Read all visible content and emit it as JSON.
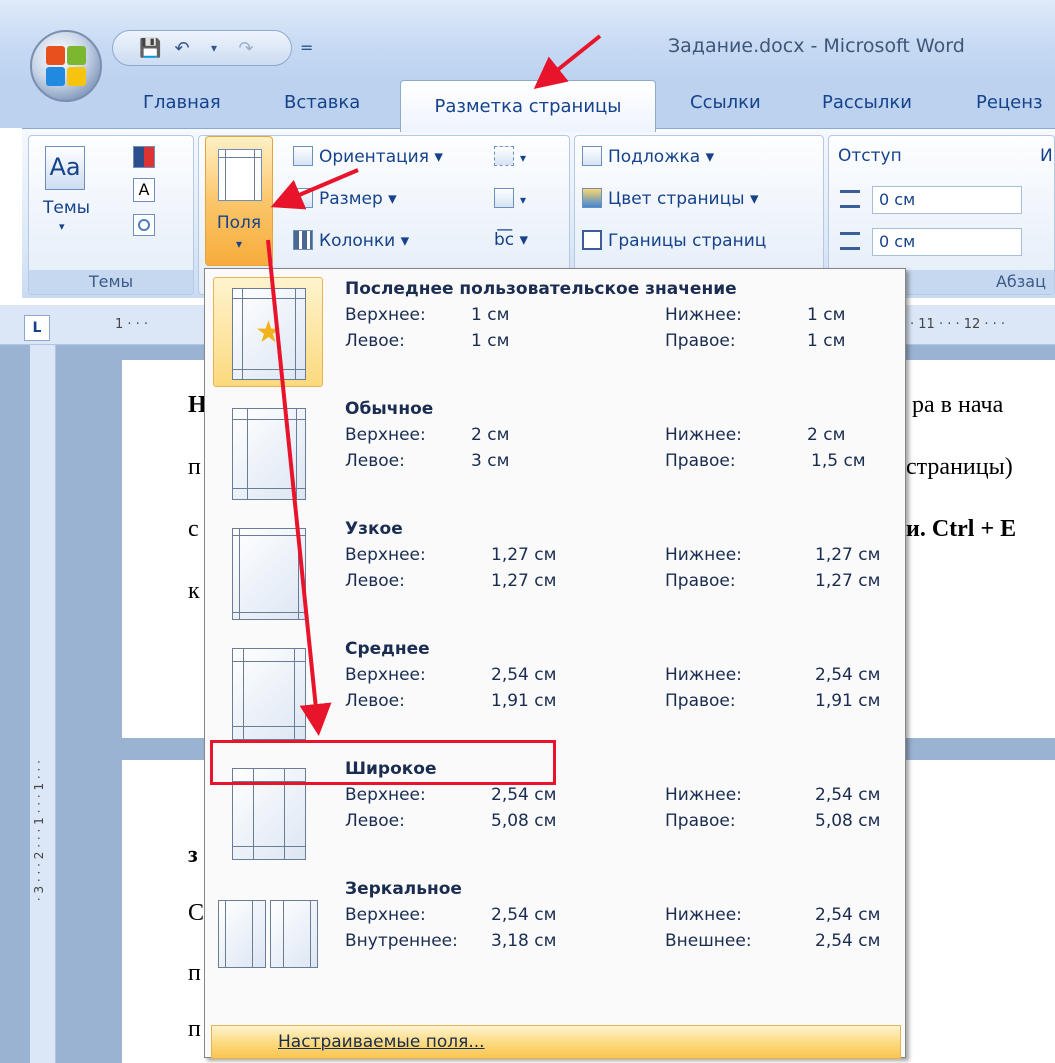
{
  "window": {
    "title": "Задание.docx - Microsoft Word"
  },
  "qat": {
    "save": "💾",
    "undo": "↶",
    "undo_arrow": "▾",
    "redo": "↷",
    "customize": "="
  },
  "tabs": [
    "Главная",
    "Вставка",
    "Разметка страницы",
    "Ссылки",
    "Рассылки",
    "Реценз"
  ],
  "ribbon": {
    "themes": {
      "button": "Темы",
      "arrow": "▾",
      "group": "Темы"
    },
    "page_setup": {
      "margins": "Поля",
      "margins_arrow": "▾",
      "orientation": "Ориентация ▾",
      "size": "Размер ▾",
      "columns": "Колонки ▾",
      "breaks_arrow": "▾",
      "line_numbers_arrow": "▾",
      "hyphenation": "b͞c ▾"
    },
    "page_background": {
      "watermark": "Подложка ▾",
      "page_color": "Цвет страницы ▾",
      "page_borders": "Границы страниц"
    },
    "paragraph": {
      "indent": "Отступ",
      "left_value": "0 см",
      "right_value": "0 см",
      "group": "Абзац",
      "spacing_initial": "И"
    }
  },
  "ruler": {
    "left_marks": "1 · · ·",
    "right_marks": "· 11 · · · 12 · · ·"
  },
  "vruler": {
    "marks": "· 3 · · · 2 · · · 1 · · · 1 · · ·"
  },
  "document": {
    "p1_l1_start": "Н",
    "p1_l1_end": "ра в нача",
    "p1_l2_start": "п",
    "p1_l2_end": "страницы)",
    "p1_l3_start": "с",
    "p1_l3_end": "и. Ctrl + E",
    "p1_l4_start": "к",
    "p2_l1": "з",
    "p2_l2": "С",
    "p2_l3": "п",
    "p2_l4": "п"
  },
  "margins_menu": {
    "items": [
      {
        "title": "Последнее пользовательское значение",
        "l1": "Верхнее:",
        "v1": "1 см",
        "l2": "Нижнее:",
        "v2": "1 см",
        "l3": "Левое:",
        "v3": "1 см",
        "l4": "Правое:",
        "v4": "1 см"
      },
      {
        "title": "Обычное",
        "l1": "Верхнее:",
        "v1": "2 см",
        "l2": "Нижнее:",
        "v2": "2 см",
        "l3": "Левое:",
        "v3": "3 см",
        "l4": "Правое:",
        "v4": "1,5 см"
      },
      {
        "title": "Узкое",
        "l1": "Верхнее:",
        "v1": "1,27 см",
        "l2": "Нижнее:",
        "v2": "1,27 см",
        "l3": "Левое:",
        "v3": "1,27 см",
        "l4": "Правое:",
        "v4": "1,27 см"
      },
      {
        "title": "Среднее",
        "l1": "Верхнее:",
        "v1": "2,54 см",
        "l2": "Нижнее:",
        "v2": "2,54 см",
        "l3": "Левое:",
        "v3": "1,91 см",
        "l4": "Правое:",
        "v4": "1,91 см"
      },
      {
        "title": "Широкое",
        "l1": "Верхнее:",
        "v1": "2,54 см",
        "l2": "Нижнее:",
        "v2": "2,54 см",
        "l3": "Левое:",
        "v3": "5,08 см",
        "l4": "Правое:",
        "v4": "5,08 см"
      },
      {
        "title": "Зеркальное",
        "l1": "Верхнее:",
        "v1": "2,54 см",
        "l2": "Нижнее:",
        "v2": "2,54 см",
        "l3": "Внутреннее:",
        "v3": "3,18 см",
        "l4": "Внешнее:",
        "v4": "2,54 см"
      }
    ],
    "custom": "Настраиваемые поля..."
  },
  "colors": {
    "accent_orange": "#f7ac3c",
    "annotation_red": "#e8142b",
    "ribbon_text": "#15428b"
  }
}
